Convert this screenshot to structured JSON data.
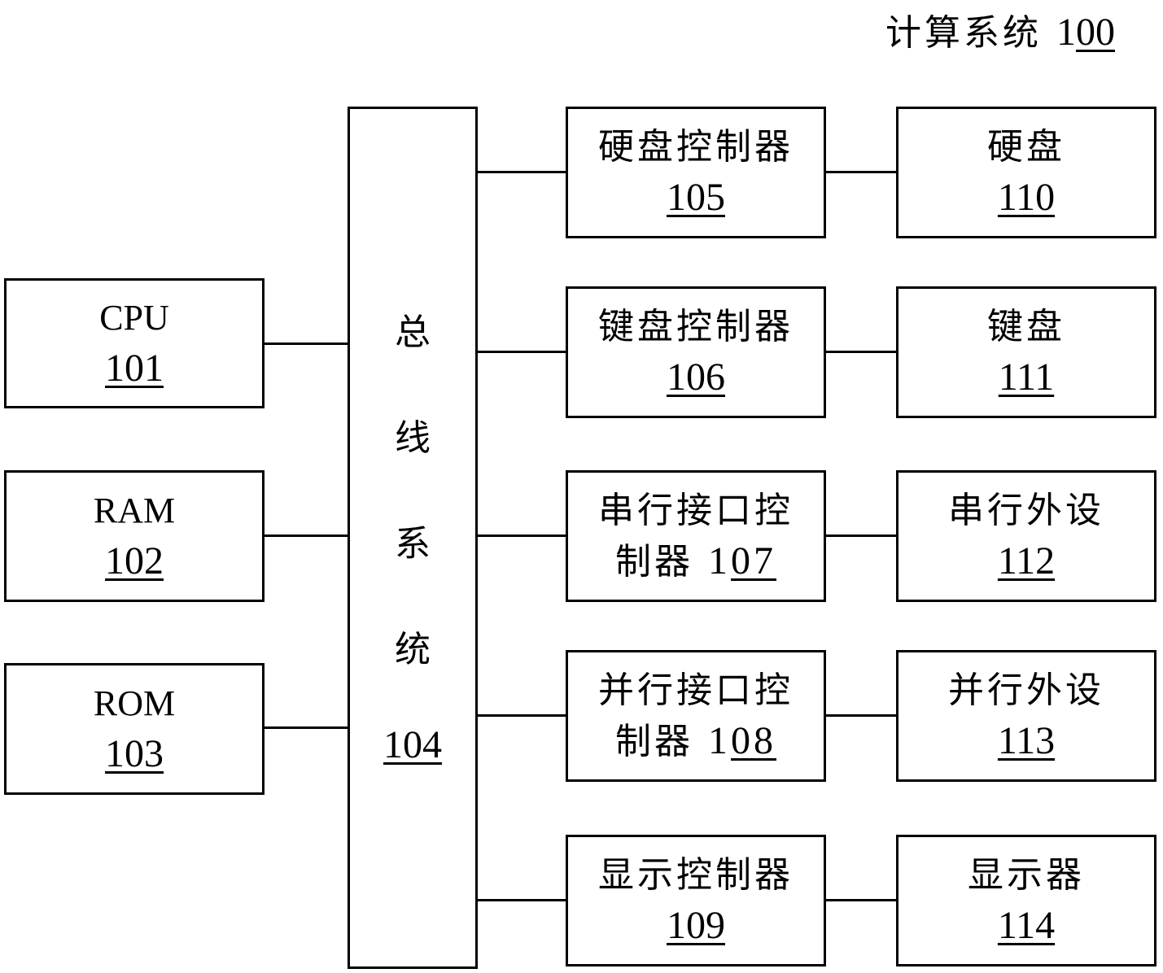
{
  "title": {
    "label": "计算系统",
    "num_prefix": "1",
    "num_underlined": "00"
  },
  "left_boxes": [
    {
      "label": "CPU",
      "num": "101"
    },
    {
      "label": "RAM",
      "num": "102"
    },
    {
      "label": "ROM",
      "num": "103"
    }
  ],
  "bus": {
    "chars": [
      "总",
      "线",
      "系",
      "统"
    ],
    "num": "104"
  },
  "controllers": [
    {
      "line1": "硬盘控制器",
      "line2_text": "",
      "num_prefix": "",
      "num": "105"
    },
    {
      "line1": "键盘控制器",
      "line2_text": "",
      "num_prefix": "",
      "num": "106"
    },
    {
      "line1": "串行接口控",
      "line2_text": "制器 ",
      "num_prefix": "1",
      "num": "07"
    },
    {
      "line1": "并行接口控",
      "line2_text": "制器 ",
      "num_prefix": "1",
      "num": "08"
    },
    {
      "line1": "显示控制器",
      "line2_text": "",
      "num_prefix": "",
      "num": "109"
    }
  ],
  "devices": [
    {
      "label": "硬盘",
      "num": "110"
    },
    {
      "label": "键盘",
      "num": "111"
    },
    {
      "label": "串行外设",
      "num": "112"
    },
    {
      "label": "并行外设",
      "num": "113"
    },
    {
      "label": "显示器",
      "num": "114"
    }
  ]
}
